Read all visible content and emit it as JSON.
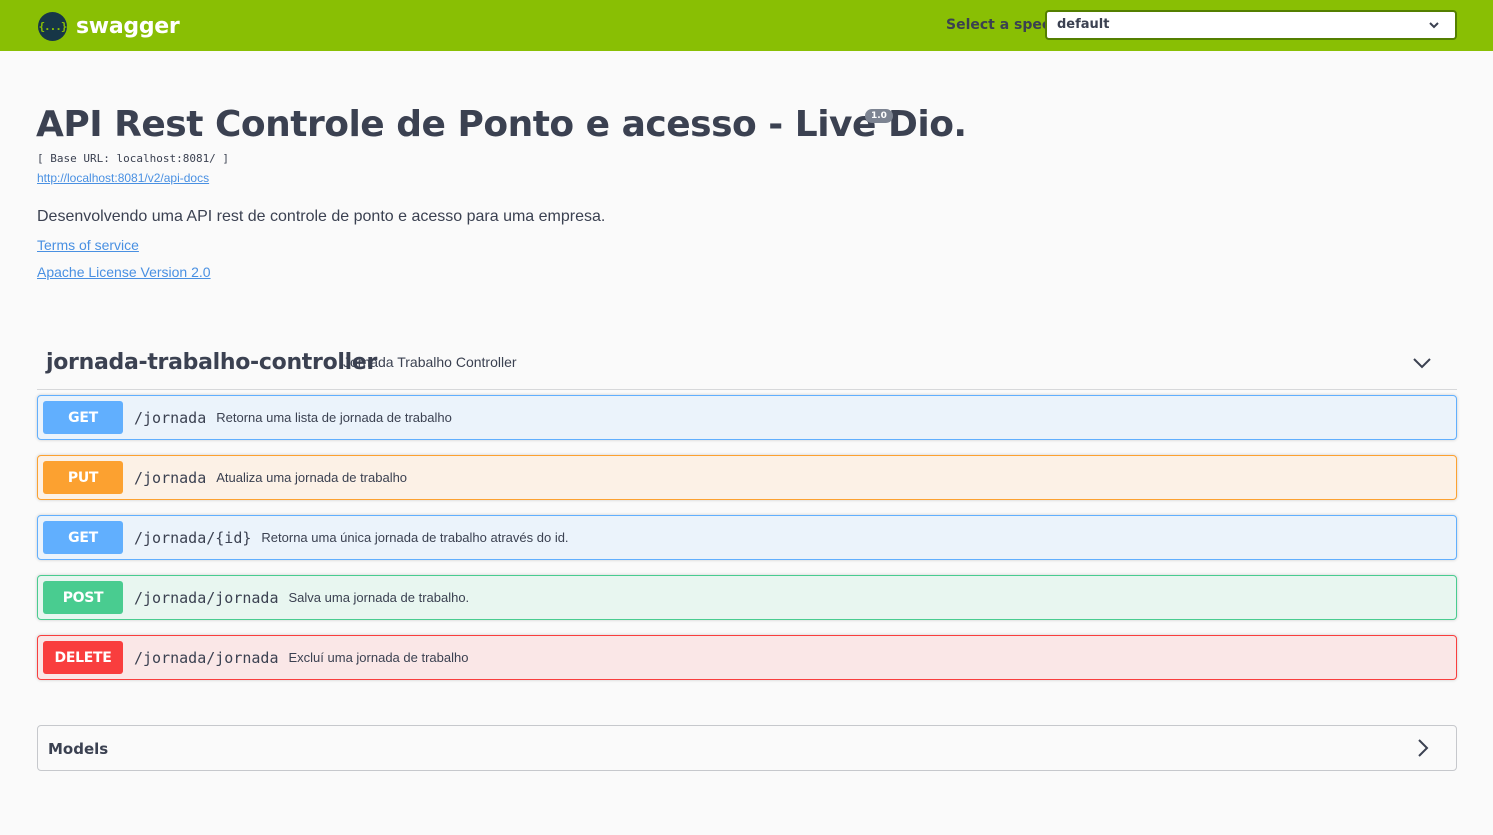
{
  "topbar": {
    "logo_icon": "{...}",
    "logo_text": "swagger",
    "spec_label": "Select a spec",
    "spec_value": "default"
  },
  "info": {
    "title": "API Rest Controle de Ponto e acesso - Live Dio.",
    "version": "1.0",
    "base_url": "[ Base URL: localhost:8081/ ]",
    "docs_link": "http://localhost:8081/v2/api-docs",
    "description": "Desenvolvendo uma API rest de controle de ponto e acesso para uma empresa.",
    "terms": "Terms of service",
    "license": "Apache License Version 2.0"
  },
  "tag": {
    "name": "jornada-trabalho-controller",
    "description": "Jornada Trabalho Controller"
  },
  "operations": [
    {
      "method": "GET",
      "path": "/jornada",
      "summary": "Retorna uma lista de jornada de trabalho",
      "color": "#61affe"
    },
    {
      "method": "PUT",
      "path": "/jornada",
      "summary": "Atualiza uma jornada de trabalho",
      "color": "#fca130"
    },
    {
      "method": "GET",
      "path": "/jornada/{id}",
      "summary": "Retorna uma única jornada de trabalho através do id.",
      "color": "#61affe"
    },
    {
      "method": "POST",
      "path": "/jornada/jornada",
      "summary": "Salva uma jornada de trabalho.",
      "color": "#49cc90"
    },
    {
      "method": "DELETE",
      "path": "/jornada/jornada",
      "summary": "Excluí uma jornada de trabalho",
      "color": "#f93e3e"
    }
  ],
  "models": {
    "label": "Models"
  },
  "colors": {
    "topbar": "#89bf04",
    "link": "#4990e2"
  }
}
